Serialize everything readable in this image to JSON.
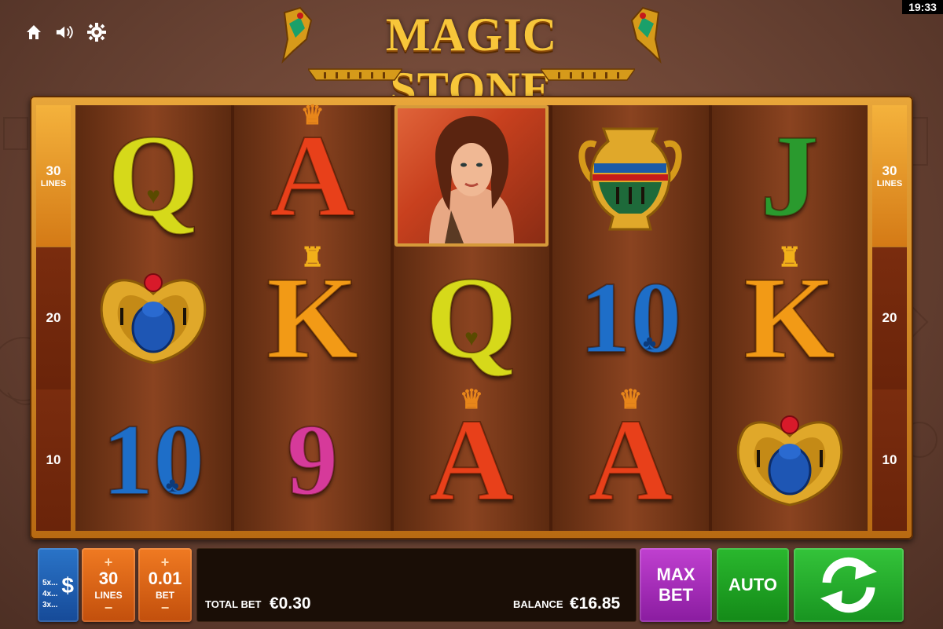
{
  "status_bar": {
    "time": "19:33"
  },
  "topbar": {
    "icons": [
      "home-icon",
      "speaker-icon",
      "gear-icon"
    ]
  },
  "logo": {
    "title": "MAGIC STONE"
  },
  "lines_indicators": {
    "left": [
      {
        "value": "30",
        "word": "LINES"
      },
      {
        "value": "20"
      },
      {
        "value": "10"
      }
    ],
    "right": [
      {
        "value": "30",
        "word": "LINES"
      },
      {
        "value": "20"
      },
      {
        "value": "10"
      }
    ]
  },
  "reels": [
    [
      "Q",
      "scarab",
      "10"
    ],
    [
      "A",
      "K",
      "9"
    ],
    [
      "woman",
      "Q",
      "A"
    ],
    [
      "vase",
      "10",
      "A"
    ],
    [
      "J",
      "K",
      "scarab"
    ]
  ],
  "controls": {
    "paytable": {
      "multipliers": [
        "5x...",
        "4x...",
        "3x..."
      ],
      "symbol": "$"
    },
    "lines": {
      "plus": "+",
      "value": "30",
      "label": "LINES",
      "minus": "−"
    },
    "bet": {
      "plus": "+",
      "value": "0.01",
      "label": "BET",
      "minus": "−"
    },
    "total_bet": {
      "label": "TOTAL BET",
      "value": "€0.30"
    },
    "balance": {
      "label": "BALANCE",
      "value": "€16.85"
    },
    "max_bet": {
      "line1": "MAX",
      "line2": "BET"
    },
    "auto": {
      "label": "AUTO"
    }
  },
  "colors": {
    "frame": "#e8a63a",
    "reel_bg": "#8a4320",
    "paytable_btn": "#2a74c8",
    "lines_btn": "#f07a22",
    "maxbet_btn": "#c040d0",
    "auto_btn": "#2ab82e",
    "spin_btn": "#34c43a"
  }
}
